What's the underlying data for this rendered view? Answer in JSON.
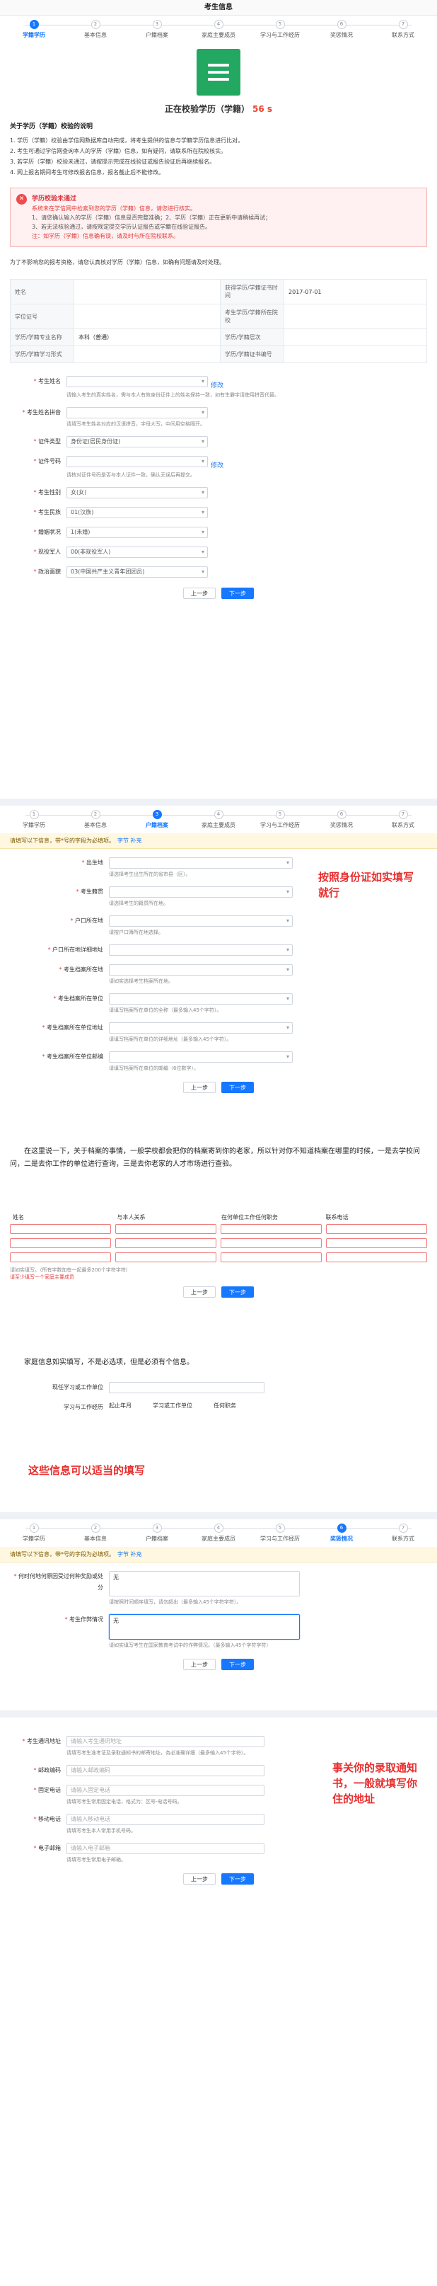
{
  "header": {
    "title": "考生信息"
  },
  "steps": [
    "学籍学历",
    "基本信息",
    "户籍档案",
    "家庭主要成员",
    "学习与工作经历",
    "奖惩情况",
    "联系方式"
  ],
  "status": {
    "title": "正在校验学历（学籍）",
    "countdown": "56 s"
  },
  "notice": {
    "heading": "关于学历（学籍）校验的说明",
    "items": [
      "1. 学历（学籍）校验由学信网数据库自动完成，将考生提供的信息与学籍学历信息进行比对。",
      "2. 考生可通过学信网查询本人的学历（学籍）信息，如有疑问，请联系所在院校核实。",
      "3. 若学历（学籍）校验未通过，请按提示完成在线验证或报告验证后再继续报名。",
      "4. 网上报名期间考生可修改报名信息，报名截止后不能修改。"
    ]
  },
  "alert": {
    "title": "学历校验未通过",
    "subtitle": "系统未在学信网中检索到您的学历（学籍）信息，请您进行核实。",
    "lines": [
      "1、请您确认输入的学历（学籍）信息是否完整准确；2、学历（学籍）正在更新中请稍候再试；",
      "3、若无法核验通过，请按规定提交学历认证报告或学籍在线验证报告。"
    ],
    "red": "注：如学历（学籍）信息确有误，请及时与所在院校联系。"
  },
  "table_intro": "为了不影响您的报考资格，请您认真核对学历（学籍）信息，如确有问题请及时处理。",
  "info_table": {
    "rows": [
      [
        "姓名",
        "",
        "获得学历/学籍证书时间",
        "2017-07-01"
      ],
      [
        "学位证号",
        "",
        "考生学历/学籍所在院校",
        ""
      ],
      [
        "学历/学籍专业名称",
        "本科（普通）",
        "学历/学籍层次",
        ""
      ],
      [
        "学历/学籍学习形式",
        "",
        "学历/学籍证书编号",
        ""
      ]
    ]
  },
  "form1": {
    "fields": [
      {
        "label": "考生姓名",
        "value": "",
        "link": "修改",
        "hint": "请输入考生的真实姓名，需与本人有效身份证件上的姓名保持一致，如有生僻字请使用拼音代替。"
      },
      {
        "label": "考生姓名拼音",
        "value": "",
        "hint": "请填写考生姓名对应的汉语拼音，字母大写，中间用空格隔开。"
      },
      {
        "label": "证件类型",
        "value": "身份证(居民身份证)",
        "hint": ""
      },
      {
        "label": "证件号码",
        "value": "",
        "link": "修改",
        "hint": "请核对证件号码是否与本人证件一致，确认无误后再提交。"
      },
      {
        "label": "考生性别",
        "value": "女(女)",
        "hint": ""
      },
      {
        "label": "考生民族",
        "value": "01(汉族)",
        "hint": ""
      },
      {
        "label": "婚姻状况",
        "value": "1(未婚)",
        "hint": ""
      },
      {
        "label": "现役军人",
        "value": "00(非现役军人)",
        "hint": ""
      },
      {
        "label": "政治面貌",
        "value": "03(中国共产主义青年团团员)",
        "hint": ""
      }
    ],
    "prev": "上一步",
    "next": "下一步"
  },
  "banner": {
    "text": "请填写以下信息，带*号的字段为必填项。",
    "link": "字节 补充"
  },
  "form2": {
    "fields": [
      {
        "label": "出生地",
        "value": "",
        "hint": "请选择考生出生所在的省市县（区）。"
      },
      {
        "label": "考生籍贯",
        "value": "",
        "hint": "请选择考生的籍贯所在地。"
      },
      {
        "label": "户口所在地",
        "value": "",
        "hint": "请按户口簿所在地选择。"
      },
      {
        "label": "户口所在地详细地址",
        "value": "",
        "hint": ""
      },
      {
        "label": "考生档案所在地",
        "value": "",
        "hint": "请如实选择考生档案所在地。"
      },
      {
        "label": "考生档案所在单位",
        "value": "",
        "hint": "请填写档案所在单位的全称（最多输入45个字符）。"
      },
      {
        "label": "考生档案所在单位地址",
        "value": "",
        "hint": "请填写档案所在单位的详细地址（最多输入45个字符）。"
      },
      {
        "label": "考生档案所在单位邮编",
        "value": "",
        "hint": "请填写档案所在单位的邮编（6位数字）。"
      }
    ],
    "prev": "上一步",
    "next": "下一步"
  },
  "annotation1": "按照身份证如实填写就行",
  "note1": "在这里说一下，关于档案的事情，一般学校都会把你的档案寄到你的老家，所以针对你不知道档案在哪里的时候，一是去学校问问，二是去你工作的单位进行查询，三是去你老家的人才市场进行查验。",
  "family": {
    "headers": [
      "姓名",
      "与本人关系",
      "在何单位工作任何职务",
      "联系电话"
    ],
    "rows": 3,
    "hint": "请如实填写。（所有字数加在一起最多200个字符字符）",
    "warn": "请至少填写一个家庭主要成员",
    "prev": "上一步",
    "next": "下一步"
  },
  "note2": "家庭信息如实填写，不是必选项，但是必须有个信息。",
  "work": {
    "row1_label": "现任学习或工作单位",
    "row1_placeholder": "",
    "row2_label": "学习与工作经历",
    "headers": [
      "起止年月",
      "学习或工作单位",
      "任何职务"
    ]
  },
  "annotation2": "这些信息可以适当的填写",
  "form3": {
    "fields": [
      {
        "label": "何时何地何原因受过何种奖励或处分",
        "value": "无",
        "hint": "请按照时间顺序填写，请勿超出（最多输入45个字符字符）。"
      },
      {
        "label": "考生作弊情况",
        "value": "无",
        "hint": "请如实填写考生在国家教育考试中的作弊情况。（最多输入45个字符字符）"
      }
    ],
    "prev": "上一步",
    "next": "下一步"
  },
  "form4": {
    "fields": [
      {
        "label": "考生通讯地址",
        "placeholder": "请输入考生通讯地址",
        "hint": "请填写考生准考证及录取通知书的邮寄地址，务必准确详细（最多输入45个字符）。"
      },
      {
        "label": "邮政编码",
        "placeholder": "请输入邮政编码",
        "hint": ""
      },
      {
        "label": "固定电话",
        "placeholder": "请输入固定电话",
        "hint": "请填写考生常用固定电话，格式为：区号-电话号码。"
      },
      {
        "label": "移动电话",
        "placeholder": "请输入移动电话",
        "hint": "请填写考生本人常用手机号码。"
      },
      {
        "label": "电子邮箱",
        "placeholder": "请输入电子邮箱",
        "hint": "请填写考生常用电子邮箱。"
      }
    ],
    "prev": "上一步",
    "next": "下一步"
  },
  "annotation3": "事关你的录取通知书，一般就填写你住的地址"
}
